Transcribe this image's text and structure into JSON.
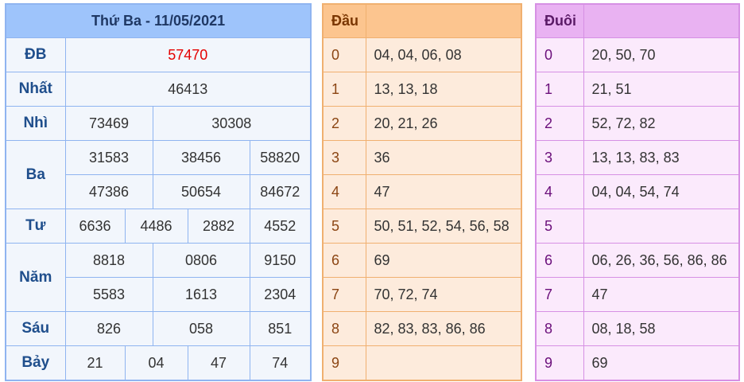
{
  "results": {
    "title": "Thứ Ba - 11/05/2021",
    "rows": [
      {
        "label": "ĐB",
        "values": [
          "57470"
        ]
      },
      {
        "label": "Nhất",
        "values": [
          "46413"
        ]
      },
      {
        "label": "Nhì",
        "values": [
          "73469",
          "30308"
        ]
      },
      {
        "label": "Ba",
        "values": [
          "31583",
          "38456",
          "58820",
          "47386",
          "50654",
          "84672"
        ]
      },
      {
        "label": "Tư",
        "values": [
          "6636",
          "4486",
          "2882",
          "4552"
        ]
      },
      {
        "label": "Năm",
        "values": [
          "8818",
          "0806",
          "9150",
          "5583",
          "1613",
          "2304"
        ]
      },
      {
        "label": "Sáu",
        "values": [
          "826",
          "058",
          "851"
        ]
      },
      {
        "label": "Bảy",
        "values": [
          "21",
          "04",
          "47",
          "74"
        ]
      }
    ]
  },
  "dau": {
    "header": "Đầu",
    "rows": [
      {
        "idx": "0",
        "values": "04, 04, 06, 08"
      },
      {
        "idx": "1",
        "values": "13, 13, 18"
      },
      {
        "idx": "2",
        "values": "20, 21, 26"
      },
      {
        "idx": "3",
        "values": "36"
      },
      {
        "idx": "4",
        "values": "47"
      },
      {
        "idx": "5",
        "values": "50, 51, 52, 54, 56, 58"
      },
      {
        "idx": "6",
        "values": "69"
      },
      {
        "idx": "7",
        "values": "70, 72, 74"
      },
      {
        "idx": "8",
        "values": "82, 83, 83, 86, 86"
      },
      {
        "idx": "9",
        "values": ""
      }
    ]
  },
  "duoi": {
    "header": "Đuôi",
    "rows": [
      {
        "idx": "0",
        "values": "20, 50, 70"
      },
      {
        "idx": "1",
        "values": "21, 51"
      },
      {
        "idx": "2",
        "values": "52, 72, 82"
      },
      {
        "idx": "3",
        "values": "13, 13, 83, 83"
      },
      {
        "idx": "4",
        "values": "04, 04, 54, 74"
      },
      {
        "idx": "5",
        "values": ""
      },
      {
        "idx": "6",
        "values": "06, 26, 36, 56, 86, 86"
      },
      {
        "idx": "7",
        "values": "47"
      },
      {
        "idx": "8",
        "values": "08, 18, 58"
      },
      {
        "idx": "9",
        "values": "69"
      }
    ]
  },
  "colors": {
    "special_prize": "#e40000",
    "results_border": "#8fb4f0",
    "dau_border": "#f0b070",
    "duoi_border": "#d690e4"
  }
}
